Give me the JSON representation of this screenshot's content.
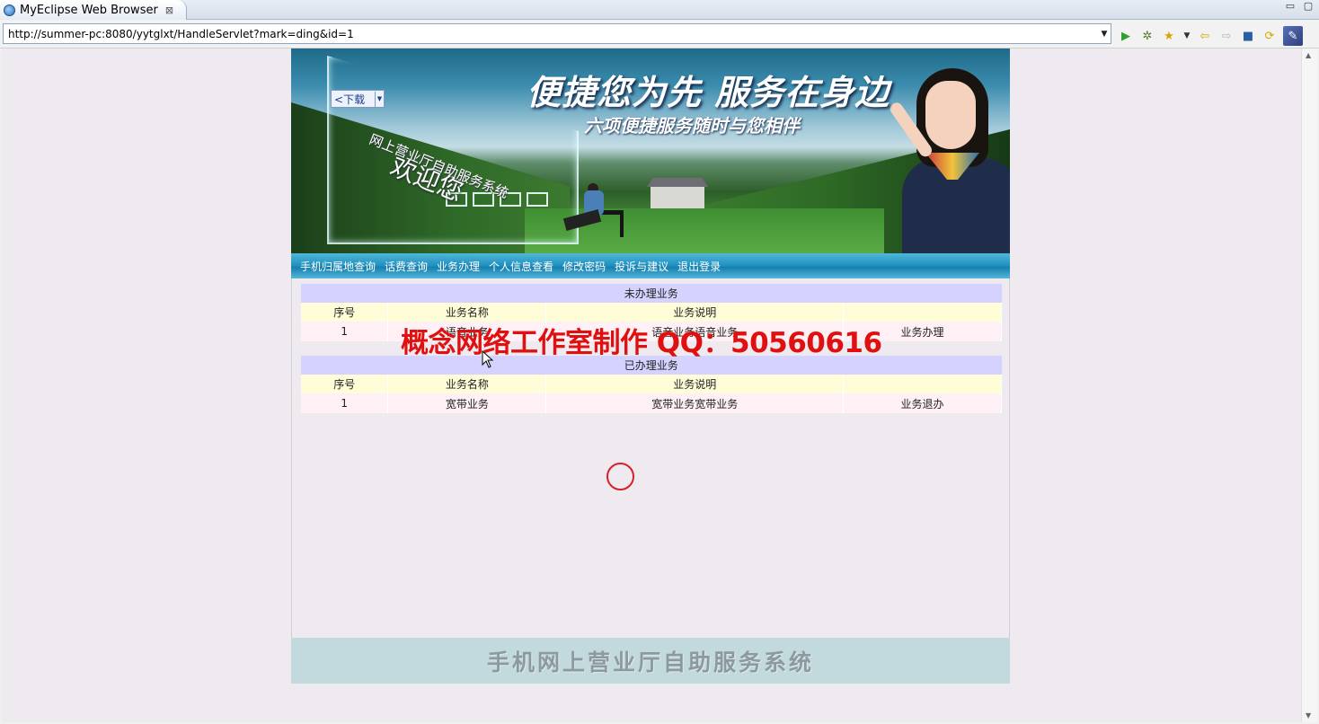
{
  "browser": {
    "tab_title": "MyEclipse Web Browser",
    "tab_close": "⊠",
    "url": "http://summer-pc:8080/yytglxt/HandleServlet?mark=ding&id=1"
  },
  "banner": {
    "slogan_main": "便捷您为先 服务在身边",
    "slogan_sub": "六项便捷服务随时与您相伴",
    "system_title": "网上营业厅自助服务系统",
    "welcome": "欢迎您",
    "download_label": "下载"
  },
  "menu": {
    "items": [
      "手机归属地查询",
      "话费查询",
      "业务办理",
      "个人信息查看",
      "修改密码",
      "投诉与建议",
      "退出登录"
    ]
  },
  "pending": {
    "caption": "未办理业务",
    "headers": [
      "序号",
      "业务名称",
      "业务说明",
      ""
    ],
    "rows": [
      {
        "index": "1",
        "name": "语音业务",
        "desc": "语音业务语音业务",
        "action": "业务办理"
      }
    ]
  },
  "done": {
    "caption": "已办理业务",
    "headers": [
      "序号",
      "业务名称",
      "业务说明",
      ""
    ],
    "rows": [
      {
        "index": "1",
        "name": "宽带业务",
        "desc": "宽带业务宽带业务",
        "action": "业务退办"
      }
    ]
  },
  "watermark": "概念网络工作室制作 QQ：50560616",
  "footer": {
    "title": "手机网上营业厅自助服务系统"
  },
  "colors": {
    "watermark": "#e01010",
    "caption_bg": "#d4d3ff",
    "header_bg": "#fffcd8",
    "row_bg": "#fff0f5",
    "menu_bg": "#1f8fbe",
    "footer_bg": "#c2dadd"
  }
}
